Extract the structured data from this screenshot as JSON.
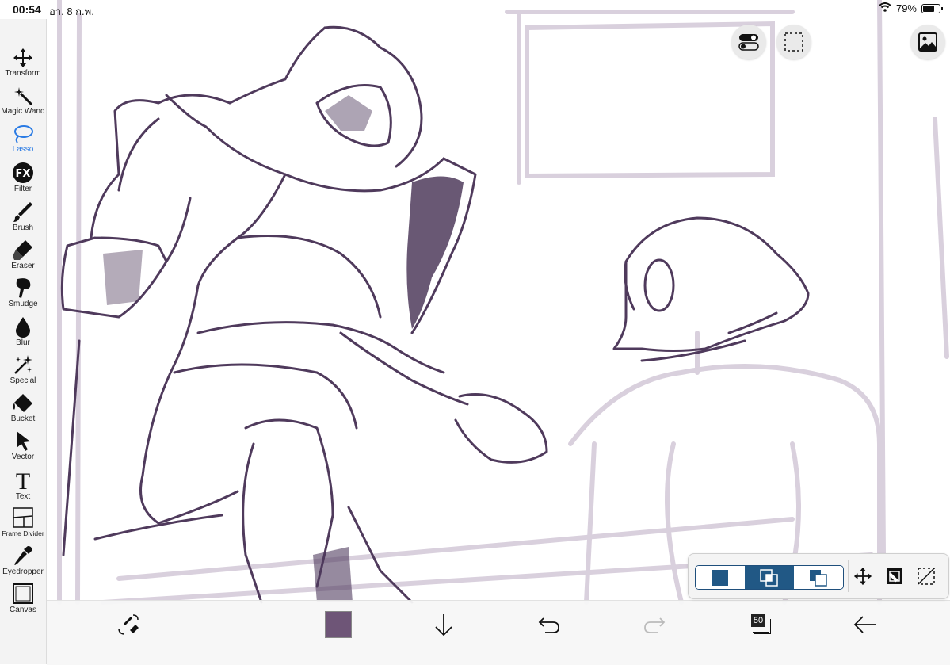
{
  "status": {
    "time": "00:54",
    "date": "อา. 8 ก.พ.",
    "battery": "79%"
  },
  "toolbar": {
    "active": "Lasso",
    "active_color": "#2a7be4",
    "tools": [
      {
        "label": "Transform",
        "icon": "move-arrows-icon"
      },
      {
        "label": "Magic Wand",
        "icon": "magic-wand-icon"
      },
      {
        "label": "Lasso",
        "icon": "lasso-icon"
      },
      {
        "label": "Filter",
        "icon": "fx-icon"
      },
      {
        "label": "Brush",
        "icon": "brush-icon"
      },
      {
        "label": "Eraser",
        "icon": "eraser-icon"
      },
      {
        "label": "Smudge",
        "icon": "smudge-icon"
      },
      {
        "label": "Blur",
        "icon": "blur-drop-icon"
      },
      {
        "label": "Special",
        "icon": "sparkle-icon"
      },
      {
        "label": "Bucket",
        "icon": "bucket-icon"
      },
      {
        "label": "Vector",
        "icon": "pointer-arrow-icon"
      },
      {
        "label": "Text",
        "icon": "text-t-icon"
      },
      {
        "label": "Frame Divider",
        "icon": "frame-divider-icon"
      },
      {
        "label": "Eyedropper",
        "icon": "eyedropper-icon"
      },
      {
        "label": "Canvas",
        "icon": "canvas-icon"
      }
    ]
  },
  "bottombar": {
    "current_color": "#6e5577",
    "layer_count": "50"
  },
  "selection_panel": {
    "mode_selected": 1,
    "accent": "#215885"
  },
  "sketch_color": "#4f3a5c"
}
